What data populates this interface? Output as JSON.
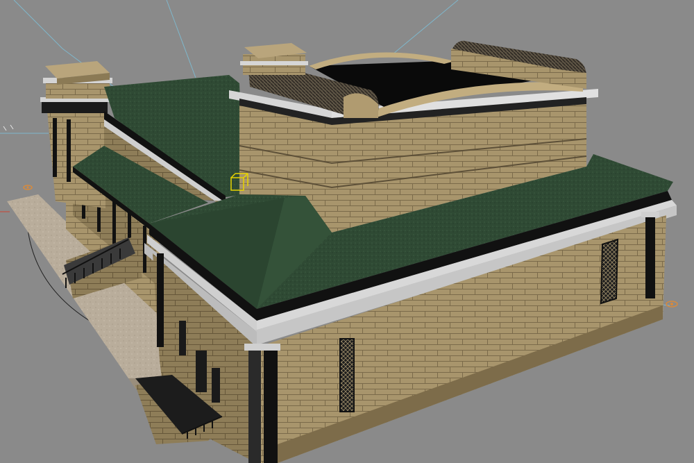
{
  "viewport": {
    "background": "#8a8a8a",
    "view": "perspective",
    "selection": "none"
  },
  "scene": {
    "model": "neoclassical-stone-building",
    "materials": {
      "roof": "#2f4a34",
      "roof_dark": "#253d2b",
      "stone": "#a8956c",
      "stone_dark": "#8a7752",
      "stone_shadow": "#6e5f42",
      "trim": "#c9c9c9",
      "fascia": "#111111",
      "ground": "#b9ad9b",
      "skylight": "#0a0a0a"
    },
    "gizmos": [
      "light-helper-left",
      "light-helper-right",
      "camera-target",
      "helper-marker"
    ]
  }
}
